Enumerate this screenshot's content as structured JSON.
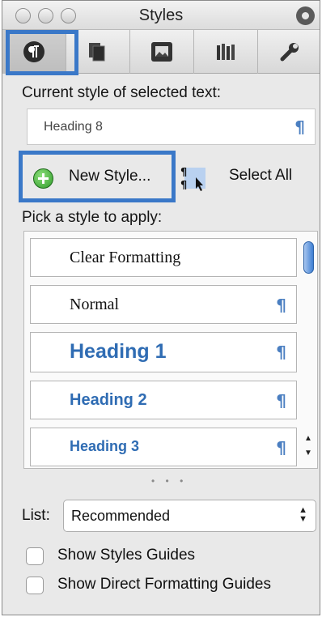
{
  "window": {
    "title": "Styles"
  },
  "toolbar": {
    "tabs": [
      {
        "icon": "pilcrow-icon",
        "selected": true
      },
      {
        "icon": "pages-icon"
      },
      {
        "icon": "picture-icon"
      },
      {
        "icon": "books-icon"
      },
      {
        "icon": "wrench-icon"
      }
    ]
  },
  "current_style": {
    "label": "Current style of selected text:",
    "value": "Heading 8",
    "pilcrow": "¶"
  },
  "actions": {
    "new_style": "New Style...",
    "select_all": "Select All"
  },
  "style_list": {
    "label": "Pick a style to apply:",
    "items": [
      {
        "label": "Clear Formatting",
        "pilcrow": ""
      },
      {
        "label": "Normal",
        "pilcrow": "¶"
      },
      {
        "label": "Heading 1",
        "pilcrow": "¶"
      },
      {
        "label": "Heading 2",
        "pilcrow": "¶"
      },
      {
        "label": "Heading 3",
        "pilcrow": "¶"
      }
    ],
    "resize_dots": "• • •"
  },
  "list_filter": {
    "label": "List:",
    "value": "Recommended"
  },
  "checkboxes": [
    {
      "label": "Show Styles Guides",
      "checked": false
    },
    {
      "label": "Show Direct Formatting Guides",
      "checked": false
    }
  ],
  "colors": {
    "accent": "#3a78c8",
    "heading_blue": "#2f6cb3",
    "pilcrow_blue": "#4b7fc1"
  }
}
